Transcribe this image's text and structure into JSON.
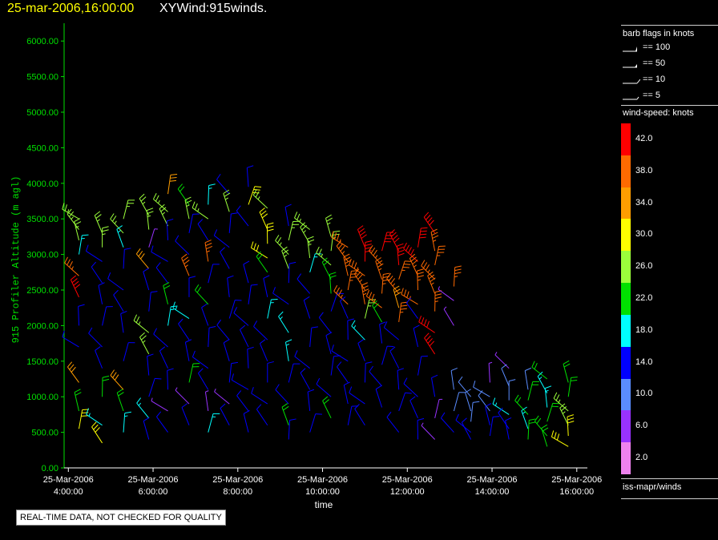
{
  "header": {
    "time_label": "25-mar-2006,16:00:00",
    "title": "XYWind:915winds."
  },
  "legend": {
    "barb_title": "barb flags in knots",
    "barb_items": [
      "== 100",
      "== 50",
      "== 10",
      "== 5"
    ],
    "speed_title": "wind-speed: knots",
    "speed_scale": [
      {
        "label": "42.0",
        "color": "#ff0000"
      },
      {
        "label": "38.0",
        "color": "#ff6a00"
      },
      {
        "label": "34.0",
        "color": "#ff9d00"
      },
      {
        "label": "30.0",
        "color": "#ffff00"
      },
      {
        "label": "26.0",
        "color": "#9bff3b"
      },
      {
        "label": "22.0",
        "color": "#00e000"
      },
      {
        "label": "18.0",
        "color": "#00ffff"
      },
      {
        "label": "14.0",
        "color": "#0000ff"
      },
      {
        "label": "10.0",
        "color": "#5a8cff"
      },
      {
        "label": "6.0",
        "color": "#9932ff"
      },
      {
        "label": "2.0",
        "color": "#ee82ee"
      }
    ],
    "source": "iss-mapr/winds"
  },
  "quality_note": "REAL-TIME DATA, NOT CHECKED FOR QUALITY",
  "chart_data": {
    "type": "scatter",
    "title": "XYWind:915winds.",
    "xlabel": "time",
    "ylabel": "915 Profiler Altitude (m agl)",
    "ylim": [
      0,
      6250
    ],
    "xlim_hours": [
      3.9,
      16.25
    ],
    "y_ticks": [
      "0.00",
      "500.00",
      "1000.00",
      "1500.00",
      "2000.00",
      "2500.00",
      "3000.00",
      "3500.00",
      "4000.00",
      "4500.00",
      "5000.00",
      "5500.00",
      "6000.00"
    ],
    "x_ticks": [
      {
        "hour": 4,
        "date": "25-Mar-2006",
        "time": "4:00:00"
      },
      {
        "hour": 6,
        "date": "25-Mar-2006",
        "time": "6:00:00"
      },
      {
        "hour": 8,
        "date": "25-Mar-2006",
        "time": "8:00:00"
      },
      {
        "hour": 10,
        "date": "25-Mar-2006",
        "time": "10:00:00"
      },
      {
        "hour": 12,
        "date": "25-Mar-2006",
        "time": "12:00:00"
      },
      {
        "hour": 14,
        "date": "25-Mar-2006",
        "time": "14:00:00"
      },
      {
        "hour": 16,
        "date": "25-Mar-2006",
        "time": "16:00:00"
      }
    ],
    "series_profiles": [
      {
        "hour": 4.25,
        "top": 3550,
        "levels": [
          [
            3500,
            26
          ],
          [
            3350,
            26
          ],
          [
            3200,
            26
          ],
          [
            3000,
            18
          ],
          [
            2700,
            38
          ],
          [
            2400,
            42
          ],
          [
            2000,
            14
          ],
          [
            1700,
            14
          ],
          [
            1200,
            34
          ],
          [
            800,
            22
          ],
          [
            550,
            30
          ]
        ]
      },
      {
        "hour": 4.8,
        "top": 3300,
        "levels": [
          [
            3300,
            26
          ],
          [
            3100,
            26
          ],
          [
            2900,
            14
          ],
          [
            2600,
            14
          ],
          [
            2300,
            14
          ],
          [
            2000,
            14
          ],
          [
            1700,
            14
          ],
          [
            1400,
            14
          ],
          [
            1000,
            22
          ],
          [
            600,
            18
          ],
          [
            350,
            30
          ]
        ]
      },
      {
        "hour": 5.3,
        "top": 3550,
        "levels": [
          [
            3500,
            26
          ],
          [
            3300,
            26
          ],
          [
            3100,
            18
          ],
          [
            2800,
            14
          ],
          [
            2500,
            14
          ],
          [
            2200,
            14
          ],
          [
            1900,
            14
          ],
          [
            1500,
            14
          ],
          [
            1100,
            34
          ],
          [
            800,
            22
          ],
          [
            500,
            18
          ]
        ]
      },
      {
        "hour": 5.9,
        "top": 3550,
        "levels": [
          [
            3550,
            26
          ],
          [
            3350,
            26
          ],
          [
            3100,
            6
          ],
          [
            2800,
            34
          ],
          [
            2500,
            14
          ],
          [
            2200,
            14
          ],
          [
            1900,
            26
          ],
          [
            1600,
            26
          ],
          [
            1300,
            14
          ],
          [
            1000,
            14
          ],
          [
            700,
            18
          ],
          [
            400,
            14
          ]
        ]
      },
      {
        "hour": 6.35,
        "top": 3800,
        "levels": [
          [
            3850,
            34
          ],
          [
            3600,
            26
          ],
          [
            3400,
            26
          ],
          [
            3200,
            14
          ],
          [
            2900,
            14
          ],
          [
            2600,
            14
          ],
          [
            2300,
            22
          ],
          [
            2000,
            18
          ],
          [
            1700,
            14
          ],
          [
            1400,
            14
          ],
          [
            1100,
            14
          ],
          [
            800,
            6
          ],
          [
            500,
            14
          ]
        ]
      },
      {
        "hour": 6.85,
        "top": 3700,
        "levels": [
          [
            3700,
            22
          ],
          [
            3500,
            26
          ],
          [
            3300,
            14
          ],
          [
            3000,
            14
          ],
          [
            2700,
            38
          ],
          [
            2400,
            14
          ],
          [
            2100,
            18
          ],
          [
            1800,
            14
          ],
          [
            1500,
            14
          ],
          [
            1200,
            22
          ],
          [
            900,
            6
          ],
          [
            600,
            14
          ]
        ]
      },
      {
        "hour": 7.3,
        "top": 3700,
        "levels": [
          [
            3700,
            18
          ],
          [
            3500,
            26
          ],
          [
            3200,
            14
          ],
          [
            2900,
            38
          ],
          [
            2600,
            14
          ],
          [
            2300,
            22
          ],
          [
            2000,
            14
          ],
          [
            1700,
            14
          ],
          [
            1400,
            14
          ],
          [
            1100,
            14
          ],
          [
            800,
            6
          ],
          [
            500,
            18
          ]
        ]
      },
      {
        "hour": 7.8,
        "top": 3850,
        "levels": [
          [
            3850,
            14
          ],
          [
            3600,
            26
          ],
          [
            3300,
            14
          ],
          [
            3100,
            14
          ],
          [
            2800,
            14
          ],
          [
            2400,
            14
          ],
          [
            2100,
            14
          ],
          [
            1800,
            14
          ],
          [
            1500,
            14
          ],
          [
            1200,
            14
          ],
          [
            900,
            6
          ],
          [
            600,
            14
          ]
        ]
      },
      {
        "hour": 8.25,
        "top": 3950,
        "levels": [
          [
            3950,
            14
          ],
          [
            3700,
            30
          ],
          [
            3400,
            14
          ],
          [
            2600,
            14
          ],
          [
            2300,
            14
          ],
          [
            2000,
            14
          ],
          [
            1700,
            14
          ],
          [
            1400,
            14
          ],
          [
            1100,
            14
          ],
          [
            800,
            14
          ],
          [
            500,
            14
          ]
        ]
      },
      {
        "hour": 8.7,
        "top": 3650,
        "levels": [
          [
            3650,
            26
          ],
          [
            3350,
            30
          ],
          [
            3150,
            30
          ],
          [
            2950,
            30
          ],
          [
            2750,
            22
          ],
          [
            2400,
            14
          ],
          [
            2100,
            18
          ],
          [
            1800,
            14
          ],
          [
            1500,
            14
          ],
          [
            1200,
            14
          ],
          [
            900,
            14
          ],
          [
            600,
            14
          ]
        ]
      },
      {
        "hour": 9.2,
        "top": 3400,
        "levels": [
          [
            3400,
            14
          ],
          [
            3200,
            26
          ],
          [
            3000,
            26
          ],
          [
            2800,
            26
          ],
          [
            2600,
            14
          ],
          [
            2300,
            14
          ],
          [
            1900,
            18
          ],
          [
            1500,
            18
          ],
          [
            1200,
            14
          ],
          [
            900,
            14
          ],
          [
            600,
            22
          ],
          [
            400,
            14
          ]
        ]
      },
      {
        "hour": 9.7,
        "top": 3350,
        "levels": [
          [
            3350,
            26
          ],
          [
            3150,
            26
          ],
          [
            2950,
            26
          ],
          [
            2750,
            18
          ],
          [
            2450,
            14
          ],
          [
            2100,
            14
          ],
          [
            1700,
            14
          ],
          [
            1400,
            14
          ],
          [
            1100,
            14
          ],
          [
            800,
            14
          ],
          [
            500,
            14
          ]
        ]
      },
      {
        "hour": 10.2,
        "top": 3250,
        "levels": [
          [
            3250,
            26
          ],
          [
            3050,
            26
          ],
          [
            2850,
            26
          ],
          [
            2650,
            22
          ],
          [
            2450,
            22
          ],
          [
            2200,
            14
          ],
          [
            1900,
            14
          ],
          [
            1600,
            14
          ],
          [
            1300,
            14
          ],
          [
            1000,
            14
          ],
          [
            700,
            22
          ]
        ]
      },
      {
        "hour": 10.6,
        "top": 3100,
        "levels": [
          [
            3100,
            38
          ],
          [
            2900,
            38
          ],
          [
            2700,
            38
          ],
          [
            2500,
            38
          ],
          [
            2300,
            38
          ],
          [
            2100,
            14
          ],
          [
            1800,
            14
          ],
          [
            1500,
            14
          ],
          [
            1200,
            14
          ],
          [
            900,
            14
          ],
          [
            600,
            14
          ]
        ]
      },
      {
        "hour": 11.0,
        "top": 3100,
        "levels": [
          [
            3100,
            42
          ],
          [
            2900,
            42
          ],
          [
            2700,
            38
          ],
          [
            2500,
            38
          ],
          [
            2300,
            38
          ],
          [
            2100,
            26
          ],
          [
            1800,
            18
          ],
          [
            1500,
            14
          ],
          [
            1200,
            14
          ],
          [
            900,
            14
          ],
          [
            600,
            14
          ]
        ]
      },
      {
        "hour": 11.4,
        "top": 3050,
        "levels": [
          [
            3050,
            42
          ],
          [
            2850,
            38
          ],
          [
            2650,
            38
          ],
          [
            2450,
            38
          ],
          [
            2250,
            38
          ],
          [
            2050,
            22
          ],
          [
            1750,
            14
          ],
          [
            1450,
            14
          ],
          [
            1150,
            14
          ],
          [
            850,
            14
          ]
        ]
      },
      {
        "hour": 11.8,
        "top": 3050,
        "levels": [
          [
            3050,
            42
          ],
          [
            2850,
            42
          ],
          [
            2650,
            38
          ],
          [
            2450,
            38
          ],
          [
            2250,
            34
          ],
          [
            2050,
            38
          ],
          [
            1800,
            14
          ],
          [
            1400,
            14
          ],
          [
            1100,
            14
          ],
          [
            800,
            14
          ],
          [
            500,
            14
          ]
        ]
      },
      {
        "hour": 12.25,
        "top": 3100,
        "levels": [
          [
            3100,
            42
          ],
          [
            2900,
            42
          ],
          [
            2700,
            38
          ],
          [
            2500,
            38
          ],
          [
            2300,
            38
          ],
          [
            2100,
            14
          ],
          [
            1700,
            14
          ],
          [
            1300,
            14
          ],
          [
            1000,
            14
          ],
          [
            700,
            14
          ],
          [
            400,
            14
          ]
        ]
      },
      {
        "hour": 12.65,
        "top": 3300,
        "levels": [
          [
            3300,
            42
          ],
          [
            3050,
            38
          ],
          [
            2850,
            38
          ],
          [
            2650,
            38
          ],
          [
            2450,
            38
          ],
          [
            2200,
            38
          ],
          [
            1900,
            42
          ],
          [
            1600,
            42
          ],
          [
            1000,
            14
          ],
          [
            700,
            6
          ],
          [
            400,
            6
          ]
        ]
      },
      {
        "hour": 13.1,
        "top": 2550,
        "levels": [
          [
            2550,
            38
          ],
          [
            2350,
            6
          ],
          [
            2000,
            6
          ],
          [
            1100,
            10
          ],
          [
            800,
            10
          ],
          [
            500,
            14
          ]
        ]
      },
      {
        "hour": 13.5,
        "top": 1000,
        "levels": [
          [
            1000,
            10
          ],
          [
            800,
            10
          ],
          [
            650,
            10
          ],
          [
            500,
            14
          ],
          [
            400,
            14
          ]
        ]
      },
      {
        "hour": 13.95,
        "top": 1200,
        "levels": [
          [
            1200,
            6
          ],
          [
            1000,
            10
          ],
          [
            800,
            10
          ],
          [
            600,
            14
          ],
          [
            450,
            14
          ]
        ]
      },
      {
        "hour": 14.4,
        "top": 1400,
        "levels": [
          [
            1400,
            6
          ],
          [
            1150,
            10
          ],
          [
            950,
            10
          ],
          [
            750,
            18
          ],
          [
            550,
            14
          ],
          [
            400,
            14
          ]
        ]
      },
      {
        "hour": 14.85,
        "top": 1100,
        "levels": [
          [
            1100,
            10
          ],
          [
            950,
            22
          ],
          [
            750,
            22
          ],
          [
            550,
            18
          ],
          [
            400,
            22
          ]
        ]
      },
      {
        "hour": 15.3,
        "top": 1250,
        "levels": [
          [
            1250,
            22
          ],
          [
            1050,
            18
          ],
          [
            850,
            18
          ],
          [
            650,
            22
          ],
          [
            450,
            22
          ],
          [
            300,
            22
          ]
        ]
      },
      {
        "hour": 15.8,
        "top": 1200,
        "levels": [
          [
            1200,
            22
          ],
          [
            1000,
            22
          ],
          [
            800,
            26
          ],
          [
            600,
            26
          ],
          [
            450,
            30
          ],
          [
            300,
            30
          ]
        ]
      }
    ]
  }
}
